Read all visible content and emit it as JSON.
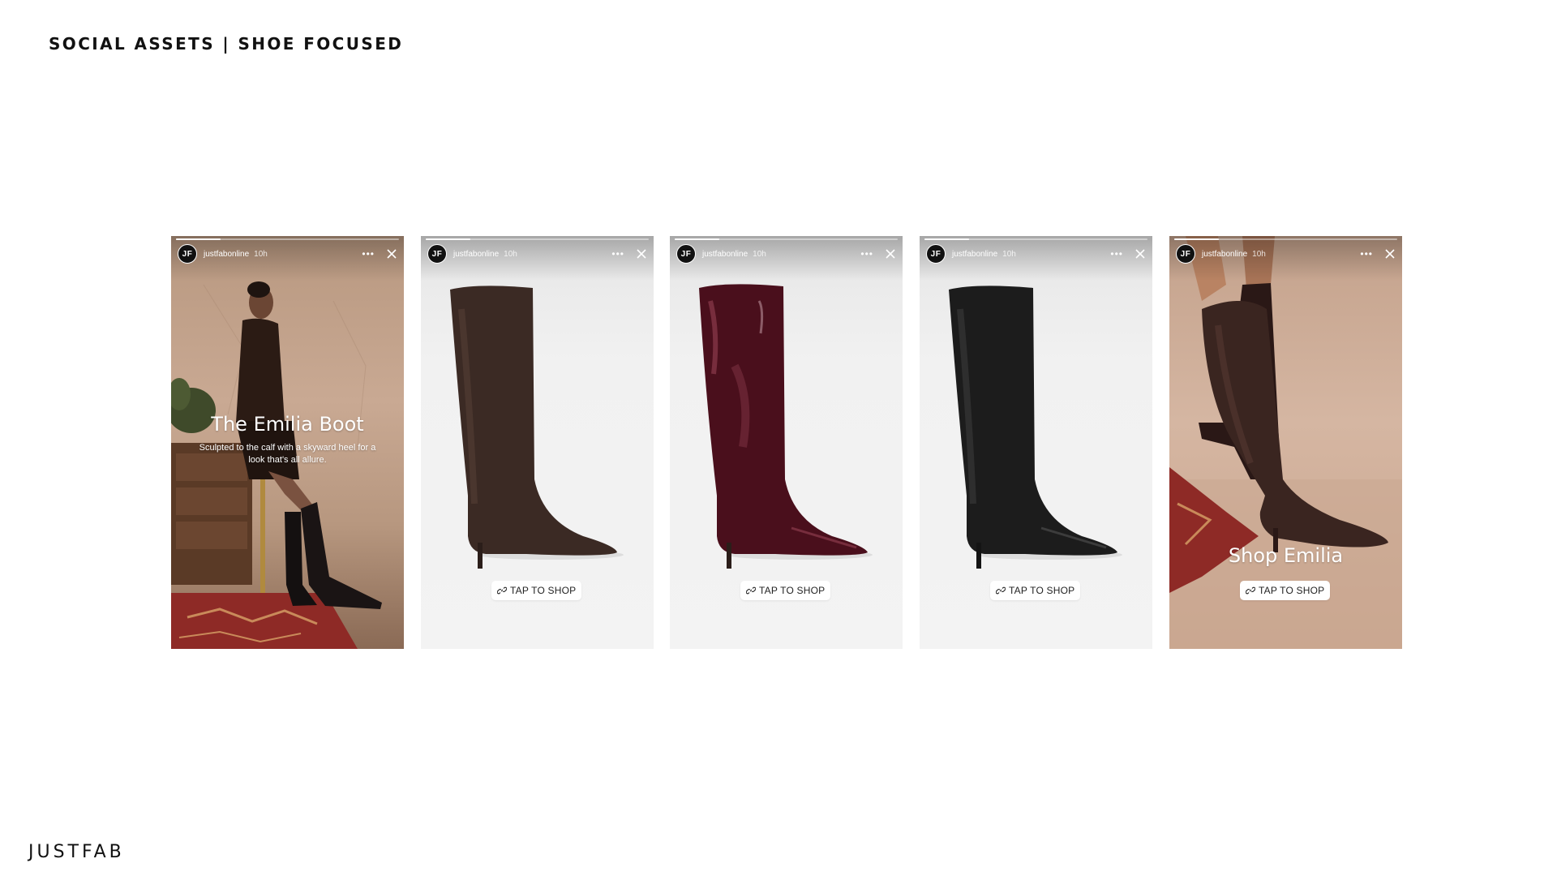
{
  "page": {
    "title": "SOCIAL ASSETS | SHOE FOCUSED",
    "brand": "JUSTFAB"
  },
  "story_header": {
    "avatar_initials": "JF",
    "username": "justfabonline",
    "time": "10h",
    "more_icon": "more-icon",
    "close_icon": "close-icon"
  },
  "stories": [
    {
      "id": "story-1",
      "headline": "The Emilia Boot",
      "subline": "Sculpted to the calf with a skyward heel for a look that's all allure.",
      "progress_fraction": 0.2
    },
    {
      "id": "story-2",
      "cta": "TAP TO SHOP",
      "product_color": "#3b2a24",
      "progress_fraction": 0.2
    },
    {
      "id": "story-3",
      "cta": "TAP TO SHOP",
      "product_color": "#4a0f1c",
      "progress_fraction": 0.2
    },
    {
      "id": "story-4",
      "cta": "TAP TO SHOP",
      "product_color": "#1c1c1c",
      "progress_fraction": 0.2
    },
    {
      "id": "story-5",
      "headline": "Shop Emilia",
      "cta": "TAP TO SHOP",
      "product_color": "#3a2520",
      "progress_fraction": 0.2
    }
  ],
  "colors": {
    "title_text": "#111111",
    "cta_background": "#ffffff",
    "header_text": "#ffffff"
  }
}
